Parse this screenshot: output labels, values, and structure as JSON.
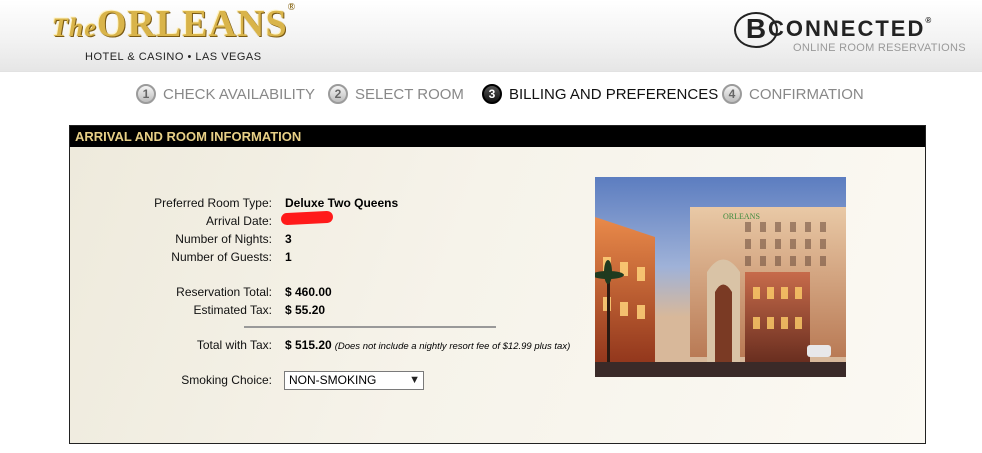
{
  "header": {
    "logo_the": "The",
    "logo_name": "ORLEANS",
    "logo_reg": "®",
    "logo_sub": "HOTEL & CASINO • LAS VEGAS",
    "bconnected_b": "B",
    "bconnected_word": "CONNECTED",
    "bconnected_reg": "®",
    "bconnected_sub": "ONLINE ROOM RESERVATIONS"
  },
  "steps": [
    {
      "num": "1",
      "label": "CHECK AVAILABILITY",
      "active": false
    },
    {
      "num": "2",
      "label": "SELECT ROOM",
      "active": false
    },
    {
      "num": "3",
      "label": "BILLING AND PREFERENCES",
      "active": true
    },
    {
      "num": "4",
      "label": "CONFIRMATION",
      "active": false
    }
  ],
  "panel": {
    "title": "ARRIVAL AND ROOM INFORMATION",
    "fields": {
      "room_type_label": "Preferred Room Type:",
      "room_type_value": "Deluxe Two Queens",
      "arrival_label": "Arrival Date:",
      "arrival_value": "",
      "nights_label": "Number of Nights:",
      "nights_value": "3",
      "guests_label": "Number of Guests:",
      "guests_value": "1",
      "total_label": "Reservation Total:",
      "total_value": "$ 460.00",
      "tax_label": "Estimated Tax:",
      "tax_value": "$ 55.20",
      "total_tax_label": "Total with Tax:",
      "total_tax_value": "$ 515.20",
      "total_tax_note": "(Does not include a nightly resort fee of $12.99 plus tax)",
      "smoking_label": "Smoking Choice:",
      "smoking_value": "NON-SMOKING"
    },
    "photo_sign": "ORLEANS"
  },
  "colors": {
    "panel_header_bg": "#000000",
    "panel_header_text": "#e7cf86",
    "logo_gold": "#d9b44a",
    "redaction": "#ff1a1a"
  }
}
